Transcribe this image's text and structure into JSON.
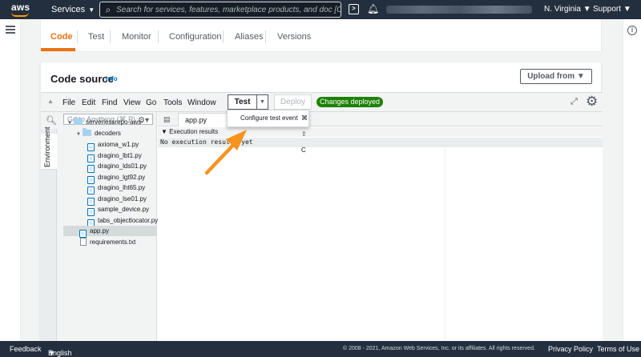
{
  "topnav": {
    "logo_text": "aws",
    "services_label": "Services",
    "search_placeholder": "Search for services, features, marketplace products, and doc [Option+S]",
    "region_label": "N. Virginia",
    "support_label": "Support"
  },
  "tabs": [
    {
      "label": "Code",
      "active": true
    },
    {
      "label": "Test"
    },
    {
      "label": "Monitor"
    },
    {
      "label": "Configuration"
    },
    {
      "label": "Aliases"
    },
    {
      "label": "Versions"
    }
  ],
  "code_source": {
    "title": "Code source",
    "info_label": "Info",
    "upload_label": "Upload from"
  },
  "ide": {
    "menus": [
      "File",
      "Edit",
      "Find",
      "View",
      "Go",
      "Tools",
      "Window"
    ],
    "test_label": "Test",
    "deploy_label": "Deploy",
    "deployed_badge": "Changes deployed",
    "tree_search_placeholder": "Go to Anything (⌘ P)",
    "environment_label": "Environment",
    "tree": {
      "root": "serverlessrepo-aws-",
      "folder": "decoders",
      "decoder_files": [
        "axioma_w1.py",
        "dragino_lbt1.py",
        "dragino_lds01.py",
        "dragino_lgt92.py",
        "dragino_lht65.py",
        "dragino_lse01.py",
        "sample_device.py",
        "tabs_objectlocator.py"
      ],
      "root_files": [
        "app.py",
        "requirements.txt"
      ]
    },
    "editor_tab": "app.py",
    "execution_results_header": "Execution results",
    "execution_output": "No execution results yet"
  },
  "test_menu": {
    "item_label": "Configure test event",
    "shortcut": "⌘ ⇧ C"
  },
  "footer": {
    "feedback": "Feedback",
    "language": "English (US)",
    "copyright": "© 2008 - 2021, Amazon Web Services, Inc. or its affiliates. All rights reserved.",
    "privacy": "Privacy Policy",
    "terms": "Terms of Use"
  },
  "colors": {
    "nav_bg": "#232f3e",
    "accent_orange": "#ec7211",
    "success_green": "#1d8102",
    "link_blue": "#0073bb",
    "arrow": "#f7931e"
  }
}
